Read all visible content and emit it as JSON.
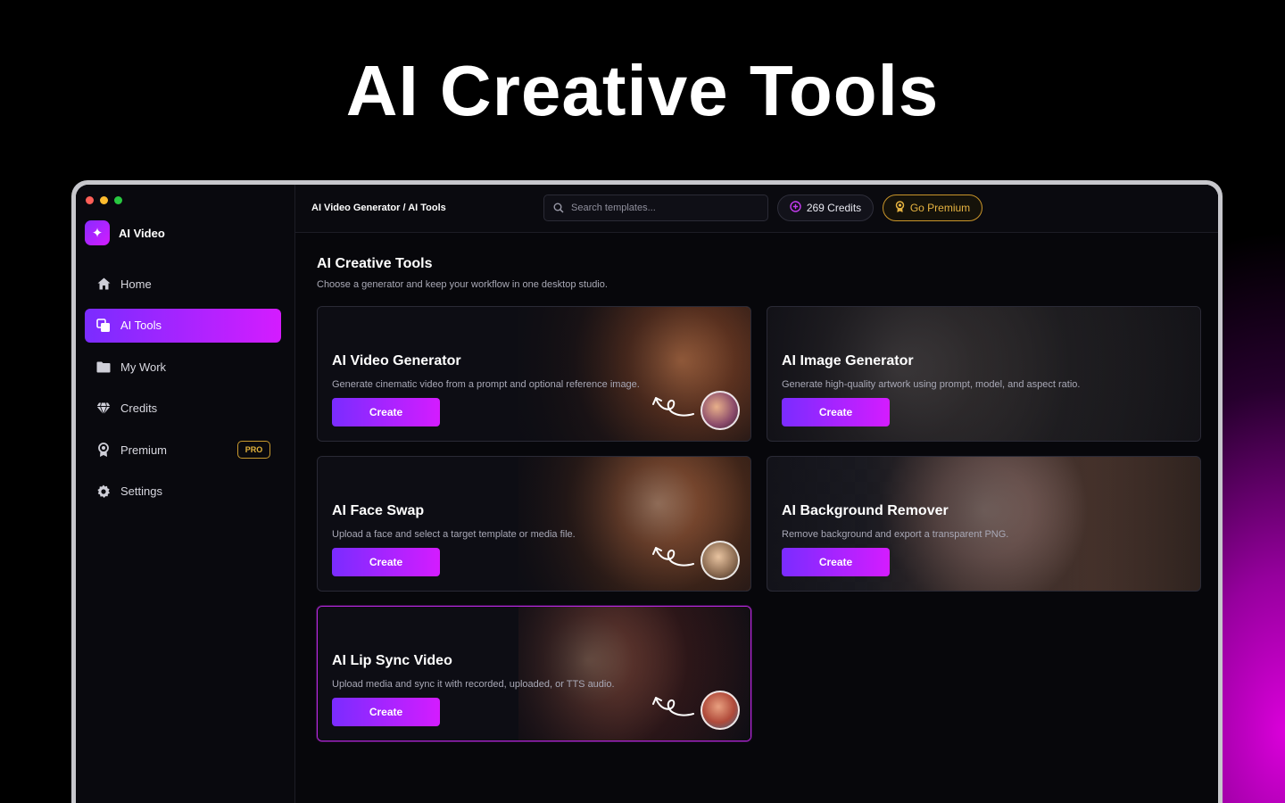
{
  "hero": {
    "title": "AI Creative Tools"
  },
  "sidebar": {
    "brand": "AI Video",
    "items": [
      {
        "label": "Home",
        "icon": "home-icon"
      },
      {
        "label": "AI Tools",
        "icon": "tools-icon",
        "active": true
      },
      {
        "label": "My Work",
        "icon": "folder-icon"
      },
      {
        "label": "Credits",
        "icon": "diamond-icon"
      },
      {
        "label": "Premium",
        "icon": "badge-icon",
        "badge": "PRO"
      },
      {
        "label": "Settings",
        "icon": "gear-icon"
      }
    ]
  },
  "topbar": {
    "breadcrumb": "AI Video Generator / AI Tools",
    "search_placeholder": "Search templates...",
    "credits": "269 Credits",
    "premium": "Go Premium"
  },
  "page": {
    "title": "AI Creative Tools",
    "subtitle": "Choose a generator and keep your workflow in one desktop studio."
  },
  "cards": [
    {
      "title": "AI Video Generator",
      "desc": "Generate cinematic video from a prompt and optional reference image.",
      "button": "Create"
    },
    {
      "title": "AI Image Generator",
      "desc": "Generate high-quality artwork using prompt, model, and aspect ratio.",
      "button": "Create"
    },
    {
      "title": "AI Face Swap",
      "desc": "Upload a face and select a target template or media file.",
      "button": "Create"
    },
    {
      "title": "AI Background Remover",
      "desc": "Remove background and export a transparent PNG.",
      "button": "Create"
    },
    {
      "title": "AI Lip Sync Video",
      "desc": "Upload media and sync it with recorded, uploaded, or TTS audio.",
      "button": "Create"
    }
  ],
  "colors": {
    "accent_start": "#7a2cff",
    "accent_end": "#d41cff",
    "premium_gold": "#e6b341"
  }
}
